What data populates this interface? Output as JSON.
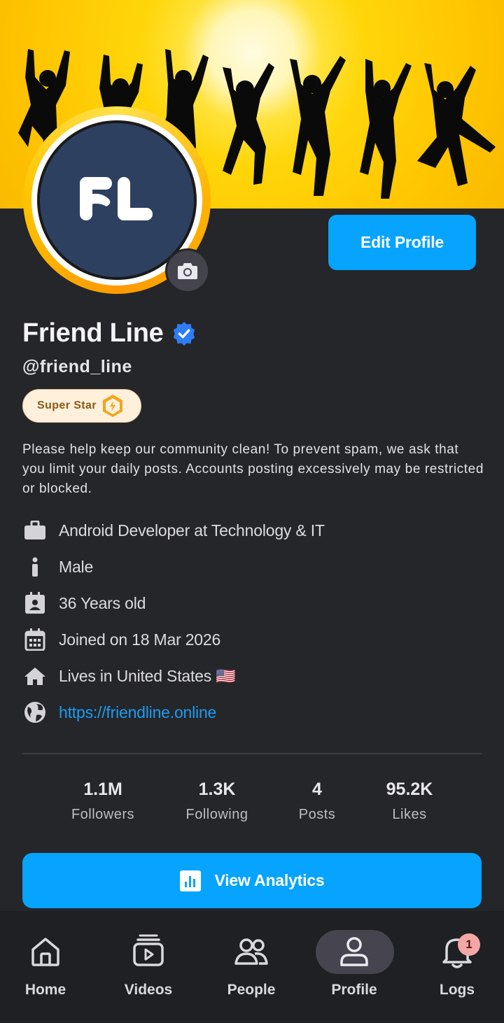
{
  "profile": {
    "name": "Friend Line",
    "handle": "@friend_line",
    "badge_label": "Super Star",
    "edit_label": "Edit Profile",
    "bio": "Please help keep our community clean! To prevent spam, we ask that you limit your daily posts. Accounts posting excessively may be restricted or blocked.",
    "avatar_logo_text": "FL"
  },
  "info": {
    "work": "Android Developer at Technology & IT",
    "gender": "Male",
    "age": "36 Years old",
    "joined": "Joined on 18 Mar 2026",
    "location": "Lives in United States 🇺🇸",
    "website": "https://friendline.online"
  },
  "stats": [
    {
      "value": "1.1M",
      "label": "Followers"
    },
    {
      "value": "1.3K",
      "label": "Following"
    },
    {
      "value": "4",
      "label": "Posts"
    },
    {
      "value": "95.2K",
      "label": "Likes"
    }
  ],
  "analytics_label": "View Analytics",
  "nav": [
    {
      "label": "Home",
      "icon": "home-icon"
    },
    {
      "label": "Videos",
      "icon": "videos-icon"
    },
    {
      "label": "People",
      "icon": "people-icon"
    },
    {
      "label": "Profile",
      "icon": "profile-icon",
      "active": true
    },
    {
      "label": "Logs",
      "icon": "bell-icon",
      "badge": "1"
    }
  ],
  "colors": {
    "accent": "#06a3ff",
    "background": "#25262a",
    "link": "#1d9bf0",
    "verified": "#2f7df6"
  }
}
